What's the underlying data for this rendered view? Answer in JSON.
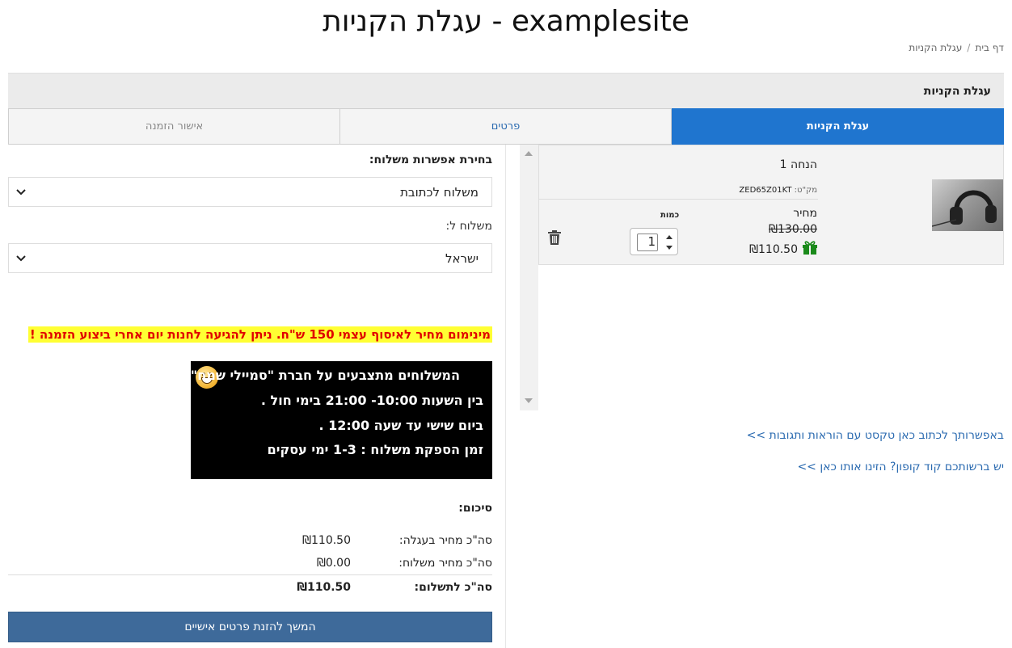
{
  "page": {
    "title": "examplesite - עגלת הקניות"
  },
  "breadcrumb": {
    "home": "דף בית",
    "separator": "/",
    "current": "עגלת הקניות"
  },
  "section": {
    "title": "עגלת הקניות"
  },
  "tabs": [
    {
      "label": "עגלת הקניות",
      "active": true
    },
    {
      "label": "פרטים",
      "active": false
    },
    {
      "label": "אישור הזמנה",
      "active": false
    }
  ],
  "shipping": {
    "heading": "בחירת אפשרות משלוח:",
    "method": "משלוח לכתובת",
    "to_label": "משלוח ל:",
    "country": "ישראל"
  },
  "notice": {
    "warning": "מינימום מחיר לאיסוף עצמי 150 ש\"ח. ניתן להגיעה לחנות יום אחרי ביצוע הזמנה !"
  },
  "shipping_info": {
    "lines": [
      "המשלוחים מתצבעים על חברת \"סמיילי שמח\"",
      "בין השעות 10:00- 21:00 בימי חול .",
      "ביום שישי עד שעה 12:00 .",
      "זמן הספקת משלוח : 1-3 ימי עסקים"
    ]
  },
  "summary": {
    "title": "סיכום:",
    "cart_total_label": "סה\"כ מחיר בעגלה:",
    "cart_total": "₪110.50",
    "shipping_total_label": "סה\"כ מחיר משלוח:",
    "shipping_total": "₪0.00",
    "grand_total_label": "סה\"כ לתשלום:",
    "grand_total": "₪110.50"
  },
  "continue_button": "המשך להזנת פרטים אישיים",
  "cart_item": {
    "name": "הנחה 1",
    "sku_label": "מק\"ט:",
    "sku": "ZED65Z01KT",
    "price_label": "מחיר",
    "old_price": "₪130.00",
    "new_price": "₪110.50",
    "quantity_label": "כמות",
    "quantity": "1"
  },
  "links": {
    "instructions": "באפשרותך לכתוב כאן טקסט עם הוראות ותגובות >>",
    "coupon": "יש ברשותכם קוד קופון? הזינו אותו כאן >>"
  },
  "colors": {
    "tab_active": "#1f75cf",
    "button": "#3e6a9a",
    "link": "#2a6ab0",
    "warning_bg": "#ffff33",
    "warning_text": "#e00000",
    "gift": "#1a8a1a"
  }
}
